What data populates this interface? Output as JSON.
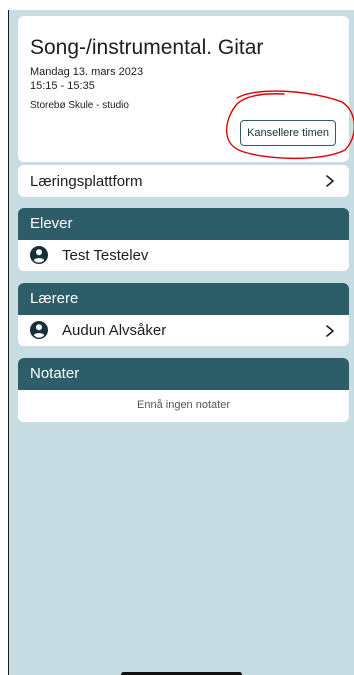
{
  "lesson": {
    "title": "Song-/instrumental. Gitar",
    "date": "Mandag 13. mars 2023",
    "time": "15:15 - 15:35",
    "location": "Storebø Skule - studio",
    "cancel_button_label": "Kansellere timen"
  },
  "learning_platform": {
    "label": "Læringsplattform",
    "icon": "chevron-right-icon"
  },
  "students": {
    "header": "Elever",
    "items": [
      {
        "name": "Test Testelev",
        "icon": "person-icon"
      }
    ]
  },
  "teachers": {
    "header": "Lærere",
    "items": [
      {
        "name": "Audun Alvsåker",
        "icon": "person-icon",
        "action_icon": "chevron-right-icon"
      }
    ]
  },
  "notes": {
    "header": "Notater",
    "empty_text": "Ennå ingen notater"
  },
  "colors": {
    "background": "#c7dde3",
    "section_header": "#2d5d68",
    "card": "#ffffff",
    "annotation_red": "#e00000"
  }
}
